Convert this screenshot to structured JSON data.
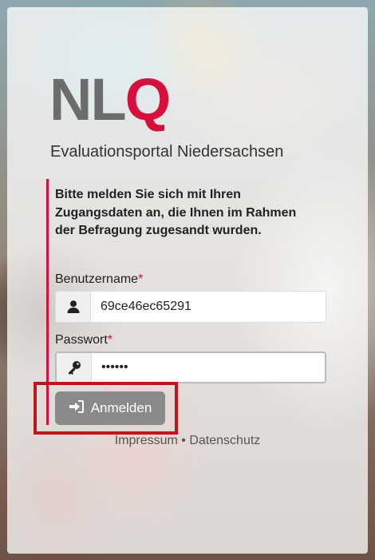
{
  "logo": {
    "part1": "NL",
    "part2": "Q"
  },
  "portal_title": "Evaluationsportal Niedersachsen",
  "intro_text": "Bitte melden Sie sich mit Ihren Zugangsdaten an, die Ihnen im Rahmen der Befragung zugesandt wurden.",
  "username": {
    "label": "Benutzername",
    "required_mark": "*",
    "value": "69ce46ec65291",
    "icon": "user-icon"
  },
  "password": {
    "label": "Passwort",
    "required_mark": "*",
    "value": "••••••",
    "icon": "key-icon"
  },
  "login_button": {
    "label": "Anmelden",
    "icon": "sign-in-icon"
  },
  "footer": {
    "impressum": "Impressum",
    "separator": " • ",
    "datenschutz": "Datenschutz"
  },
  "colors": {
    "brand_red": "#d60f3c",
    "logo_grey": "#6c6c6c",
    "button_grey": "#8a8a8a",
    "highlight_red": "#c0151c"
  }
}
